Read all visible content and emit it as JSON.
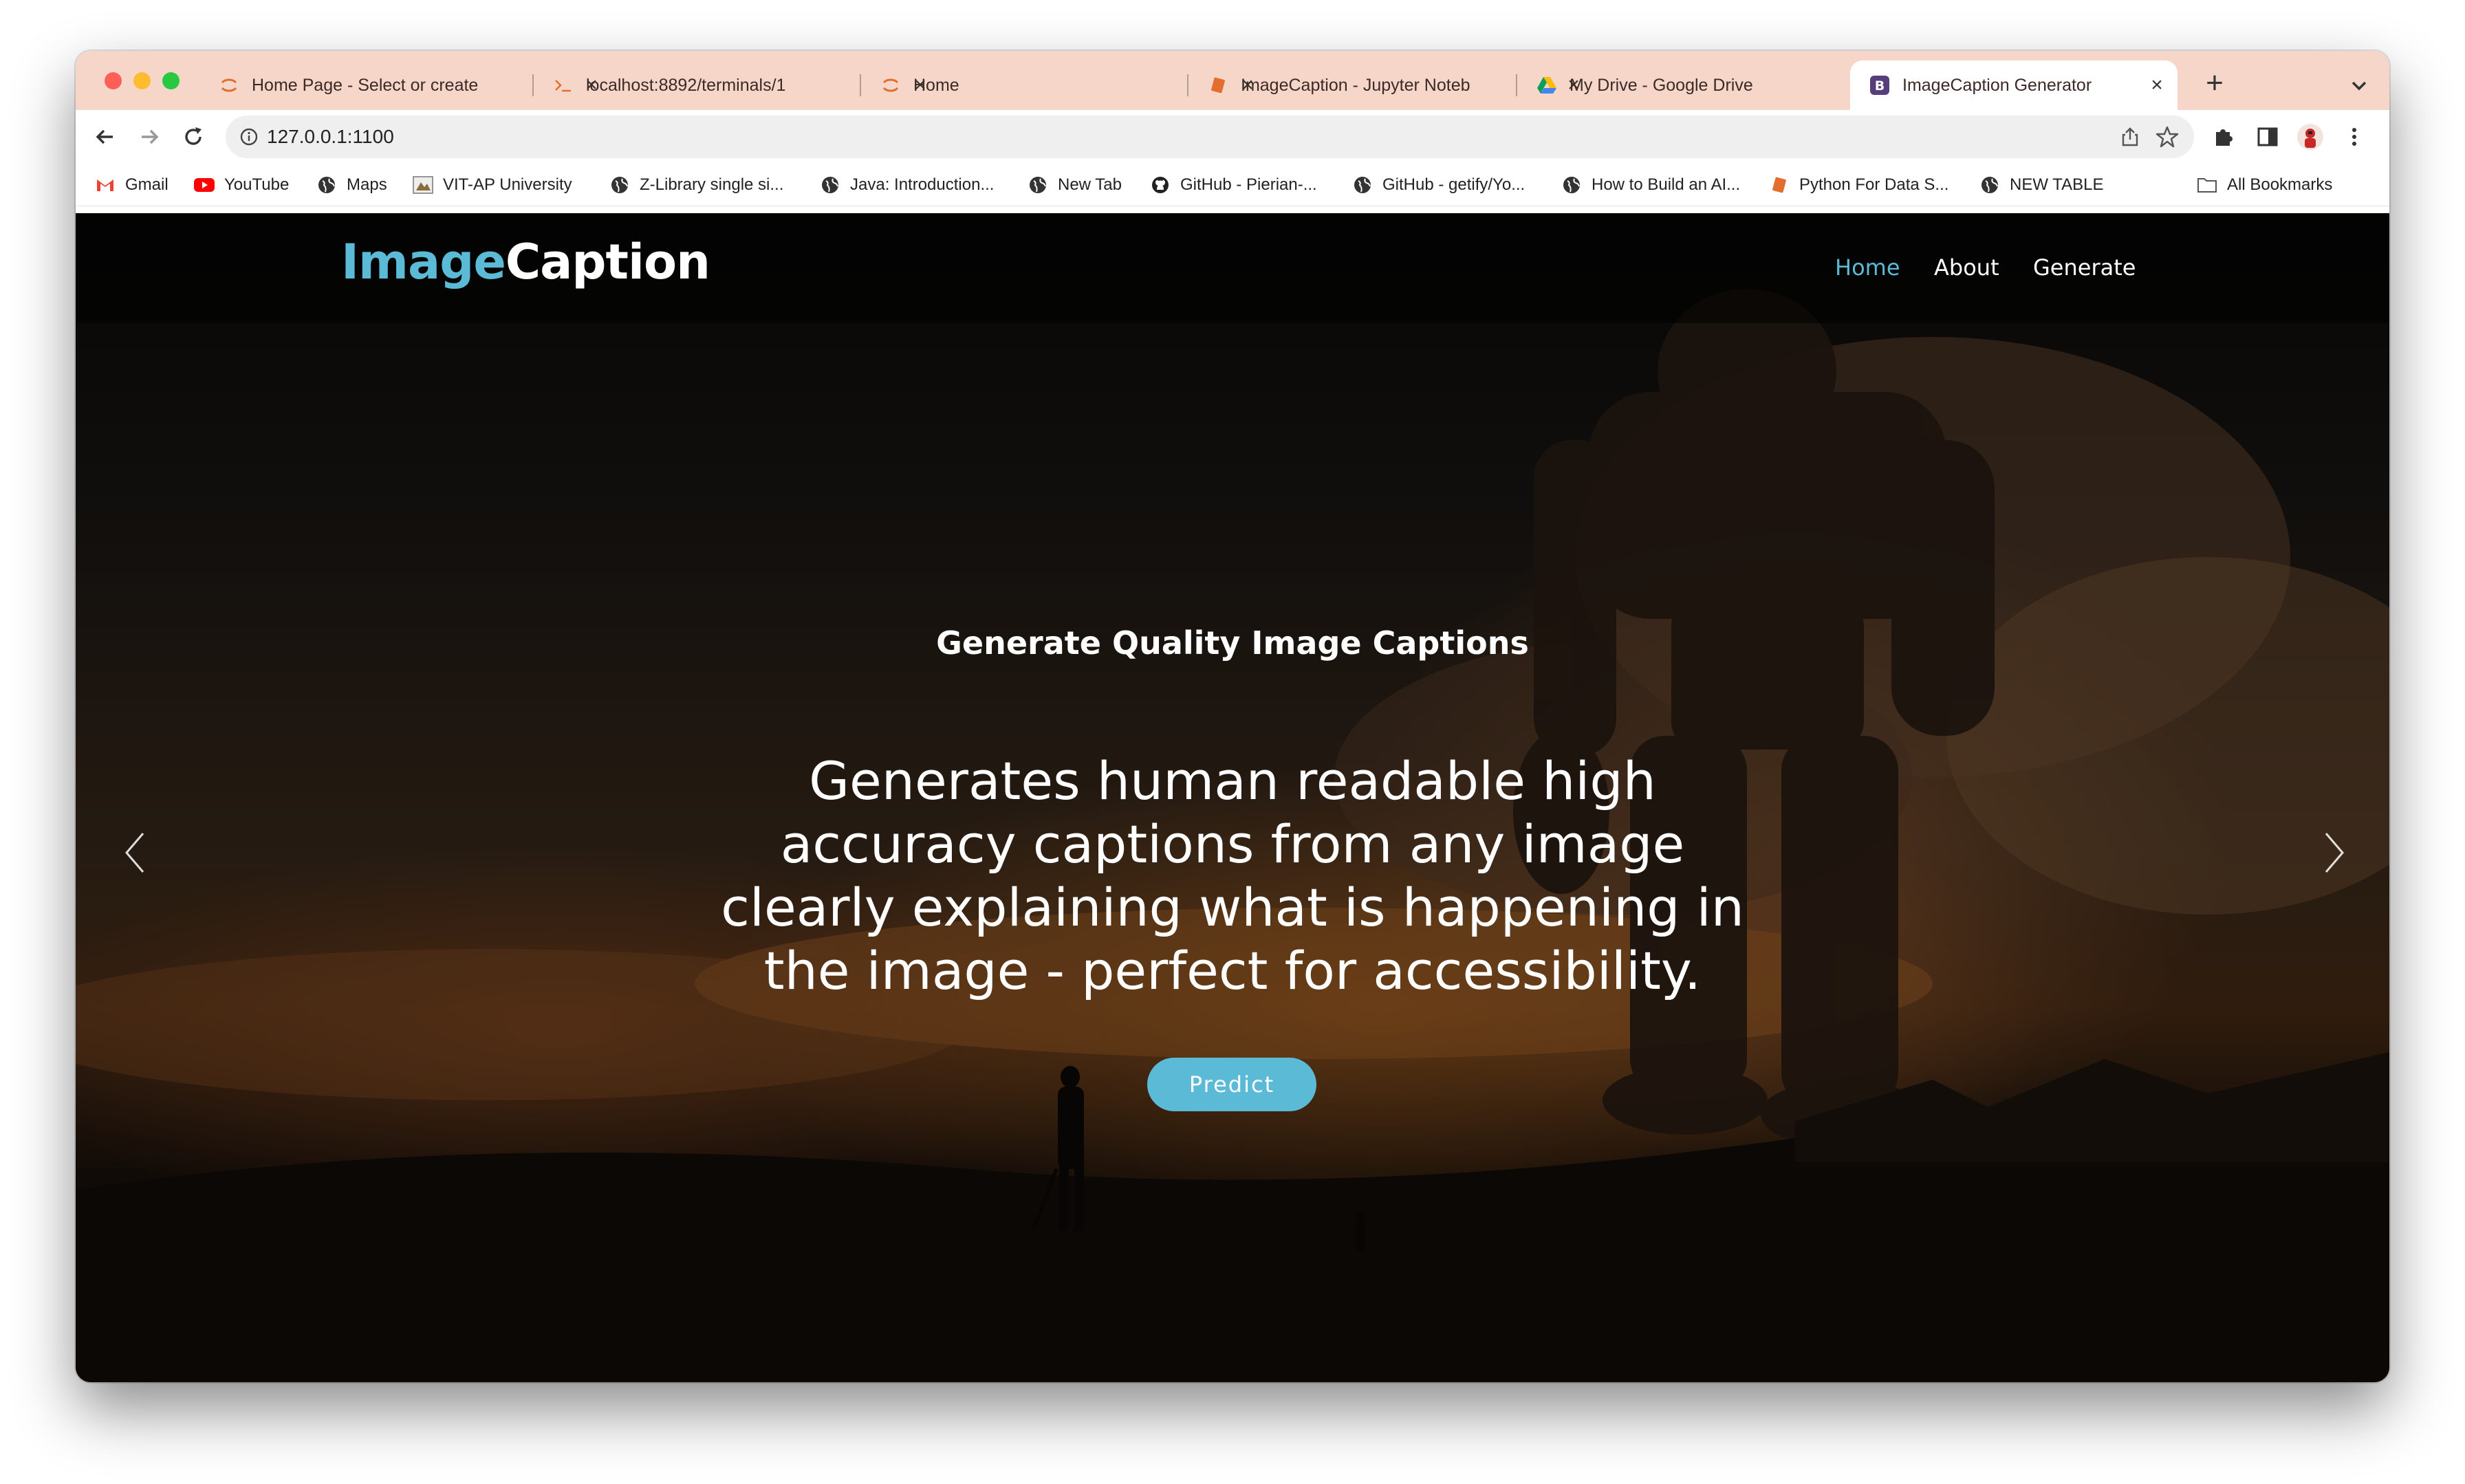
{
  "browser": {
    "tabs": [
      {
        "title": "Home Page - Select or create",
        "icon": "jupyter-icon"
      },
      {
        "title": "localhost:8892/terminals/1",
        "icon": "terminal-icon"
      },
      {
        "title": "Home",
        "icon": "jupyter-icon"
      },
      {
        "title": "ImageCaption - Jupyter Noteb",
        "icon": "notebook-icon"
      },
      {
        "title": "My Drive - Google Drive",
        "icon": "google-drive-icon"
      },
      {
        "title": "ImageCaption Generator",
        "icon": "bootstrap-icon",
        "active": true
      }
    ],
    "url": "127.0.0.1:1100",
    "bookmarks": [
      {
        "label": "Gmail",
        "icon": "gmail-icon"
      },
      {
        "label": "YouTube",
        "icon": "youtube-icon"
      },
      {
        "label": "Maps",
        "icon": "globe-icon"
      },
      {
        "label": "VIT-AP University",
        "icon": "university-icon"
      },
      {
        "label": "Z-Library single si...",
        "icon": "globe-icon"
      },
      {
        "label": "Java: Introduction...",
        "icon": "globe-icon"
      },
      {
        "label": "New Tab",
        "icon": "globe-icon"
      },
      {
        "label": "GitHub - Pierian-...",
        "icon": "github-icon"
      },
      {
        "label": "GitHub - getify/Yo...",
        "icon": "globe-icon"
      },
      {
        "label": "How to Build an AI...",
        "icon": "globe-icon"
      },
      {
        "label": "Python For Data S...",
        "icon": "notebook-icon"
      },
      {
        "label": "NEW TABLE",
        "icon": "globe-icon"
      }
    ],
    "all_bookmarks": "All Bookmarks"
  },
  "site": {
    "logo_part1": "Image",
    "logo_part2": "Caption",
    "nav": [
      "Home",
      "About",
      "Generate"
    ],
    "active_nav": "Home"
  },
  "hero": {
    "kicker": "Generate Quality Image Captions",
    "text": "Generates human readable high accuracy captions from any image clearly explaining what is happening in the image - perfect for accessibility.",
    "button": "Predict"
  },
  "carousel": {
    "slides": 3,
    "active_slide": 3
  },
  "colors": {
    "accent": "#5bbad5",
    "tab_strip": "#f6d6c9"
  }
}
